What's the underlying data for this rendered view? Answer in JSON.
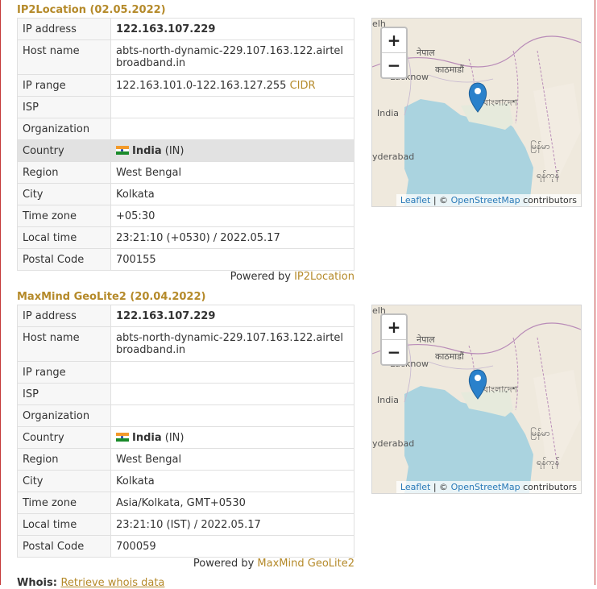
{
  "sections": [
    {
      "title": "IP2Location (02.05.2022)",
      "rows": [
        {
          "label": "IP address",
          "value": "122.163.107.229"
        },
        {
          "label": "Host name",
          "value": "abts-north-dynamic-229.107.163.122.airtelbroadband.in"
        },
        {
          "label": "IP range",
          "value": "122.163.101.0-122.163.127.255",
          "link": "CIDR"
        },
        {
          "label": "ISP",
          "value": ""
        },
        {
          "label": "Organization",
          "value": ""
        },
        {
          "label": "Country",
          "value": "India",
          "code": "(IN)"
        },
        {
          "label": "Region",
          "value": "West Bengal"
        },
        {
          "label": "City",
          "value": "Kolkata"
        },
        {
          "label": "Time zone",
          "value": "+05:30"
        },
        {
          "label": "Local time",
          "value": "23:21:10 (+0530) / 2022.05.17"
        },
        {
          "label": "Postal Code",
          "value": "700155"
        }
      ],
      "powered_prefix": "Powered by",
      "powered_link": "IP2Location"
    },
    {
      "title": "MaxMind GeoLite2 (20.04.2022)",
      "rows": [
        {
          "label": "IP address",
          "value": "122.163.107.229"
        },
        {
          "label": "Host name",
          "value": "abts-north-dynamic-229.107.163.122.airtelbroadband.in"
        },
        {
          "label": "IP range",
          "value": ""
        },
        {
          "label": "ISP",
          "value": ""
        },
        {
          "label": "Organization",
          "value": ""
        },
        {
          "label": "Country",
          "value": "India",
          "code": "(IN)"
        },
        {
          "label": "Region",
          "value": "West Bengal"
        },
        {
          "label": "City",
          "value": "Kolkata"
        },
        {
          "label": "Time zone",
          "value": "Asia/Kolkata, GMT+0530"
        },
        {
          "label": "Local time",
          "value": "23:21:10 (IST) / 2022.05.17"
        },
        {
          "label": "Postal Code",
          "value": "700059"
        }
      ],
      "powered_prefix": "Powered by",
      "powered_link": "MaxMind GeoLite2"
    }
  ],
  "map": {
    "zoom_in": "+",
    "zoom_out": "−",
    "attrib_leaflet": "Leaflet",
    "attrib_sep": "| ©",
    "attrib_osm": "OpenStreetMap",
    "attrib_suffix": "contributors",
    "labels": {
      "nepal": "नेपाल",
      "kathmandu": "काठमाडौं",
      "lucknow": "Lucknow",
      "india": "India",
      "bangladesh": "বাংলাদেশ",
      "hyderabad": "yderabad",
      "myanmar": "မြန်မာ",
      "mandalay": "ရန်ကုန်",
      "elhi": "elh"
    },
    "colors": {
      "water": "#aad3df",
      "land": "#efe9dd",
      "border": "#b98cb8",
      "marker": "#2a81cb"
    }
  },
  "whois": {
    "label": "Whois:",
    "link": "Retrieve whois data"
  }
}
